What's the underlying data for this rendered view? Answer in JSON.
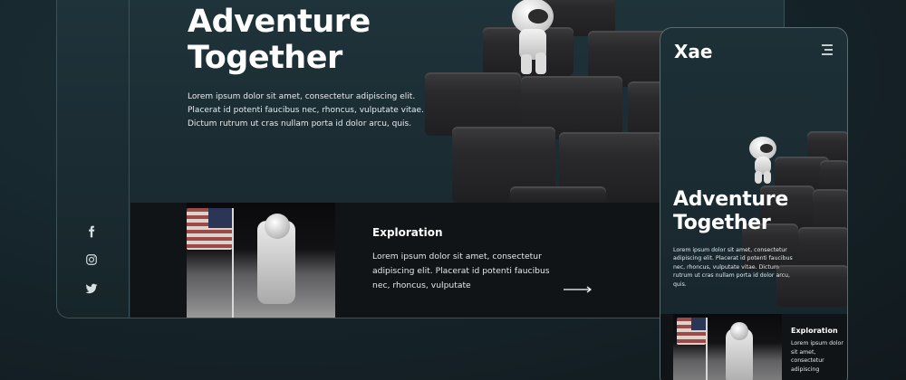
{
  "desktop": {
    "hero": {
      "title": "Adventure Together",
      "text": "Lorem ipsum dolor sit amet, consectetur adipiscing elit. Placerat id potenti faucibus nec, rhoncus, vulputate vitae. Dictum rutrum ut cras nullam porta id dolor arcu, quis."
    },
    "social_icons": [
      "facebook-icon",
      "instagram-icon",
      "twitter-icon"
    ],
    "exploration": {
      "title": "Exploration",
      "text": "Lorem ipsum dolor sit amet, consectetur adipiscing elit. Placerat id potenti faucibus nec, rhoncus, vulputate"
    }
  },
  "mobile": {
    "logo": "Xae",
    "hero": {
      "title": "Adventure Together",
      "text": "Lorem ipsum dolor sit amet, consectetur adipiscing elit. Placerat id potenti faucibus nec, rhoncus, vulputate vitae. Dictum rutrum ut cras nullam porta id dolor arcu, quis."
    },
    "exploration": {
      "title": "Exploration",
      "text": "Lorem ipsum dolor sit amet, consectetur adipiscing"
    }
  },
  "colors": {
    "background": "#16262c",
    "frame_border": "#3e5158",
    "band": "#111416",
    "text": "#ffffff"
  }
}
